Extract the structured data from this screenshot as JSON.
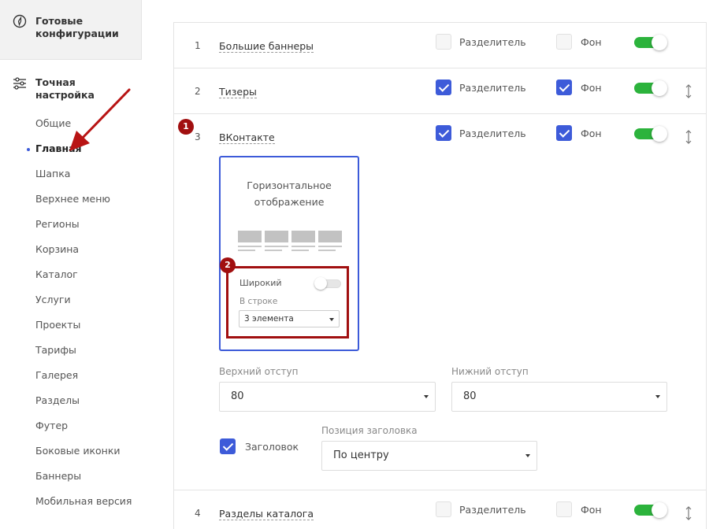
{
  "sidebar": {
    "top_title": "Готовые конфигурации",
    "section_title": "Точная настройка",
    "items": [
      {
        "label": "Общие"
      },
      {
        "label": "Главная"
      },
      {
        "label": "Шапка"
      },
      {
        "label": "Верхнее меню"
      },
      {
        "label": "Регионы"
      },
      {
        "label": "Корзина"
      },
      {
        "label": "Каталог"
      },
      {
        "label": "Услуги"
      },
      {
        "label": "Проекты"
      },
      {
        "label": "Тарифы"
      },
      {
        "label": "Галерея"
      },
      {
        "label": "Разделы"
      },
      {
        "label": "Футер"
      },
      {
        "label": "Боковые иконки"
      },
      {
        "label": "Баннеры"
      },
      {
        "label": "Мобильная версия"
      }
    ],
    "active_index": 1
  },
  "rows": [
    {
      "num": "1",
      "name": "Большие баннеры",
      "divider_label": "Разделитель",
      "divider_checked": false,
      "bg_label": "Фон",
      "bg_checked": false,
      "enabled": true
    },
    {
      "num": "2",
      "name": "Тизеры",
      "divider_label": "Разделитель",
      "divider_checked": true,
      "bg_label": "Фон",
      "bg_checked": true,
      "enabled": true
    },
    {
      "num": "3",
      "name": "ВКонтакте",
      "divider_label": "Разделитель",
      "divider_checked": true,
      "bg_label": "Фон",
      "bg_checked": true,
      "enabled": true
    },
    {
      "num": "4",
      "name": "Разделы каталога",
      "divider_label": "Разделитель",
      "divider_checked": false,
      "bg_label": "Фон",
      "bg_checked": false,
      "enabled": true
    }
  ],
  "expanded": {
    "card_title": "Горизонтальное отображение",
    "wide_label": "Широкий",
    "wide_enabled": false,
    "in_row_label": "В строке",
    "in_row_value": "3 элемента",
    "top_padding_label": "Верхний отступ",
    "top_padding_value": "80",
    "bottom_padding_label": "Нижний отступ",
    "bottom_padding_value": "80",
    "heading_label": "Заголовок",
    "heading_checked": true,
    "heading_position_label": "Позиция заголовка",
    "heading_position_value": "По центру"
  },
  "annotations": {
    "badge1": "1",
    "badge2": "2"
  },
  "colors": {
    "accent_blue": "#3d5bd9",
    "toggle_green": "#2cb33c",
    "annotation_red": "#a10f10"
  }
}
